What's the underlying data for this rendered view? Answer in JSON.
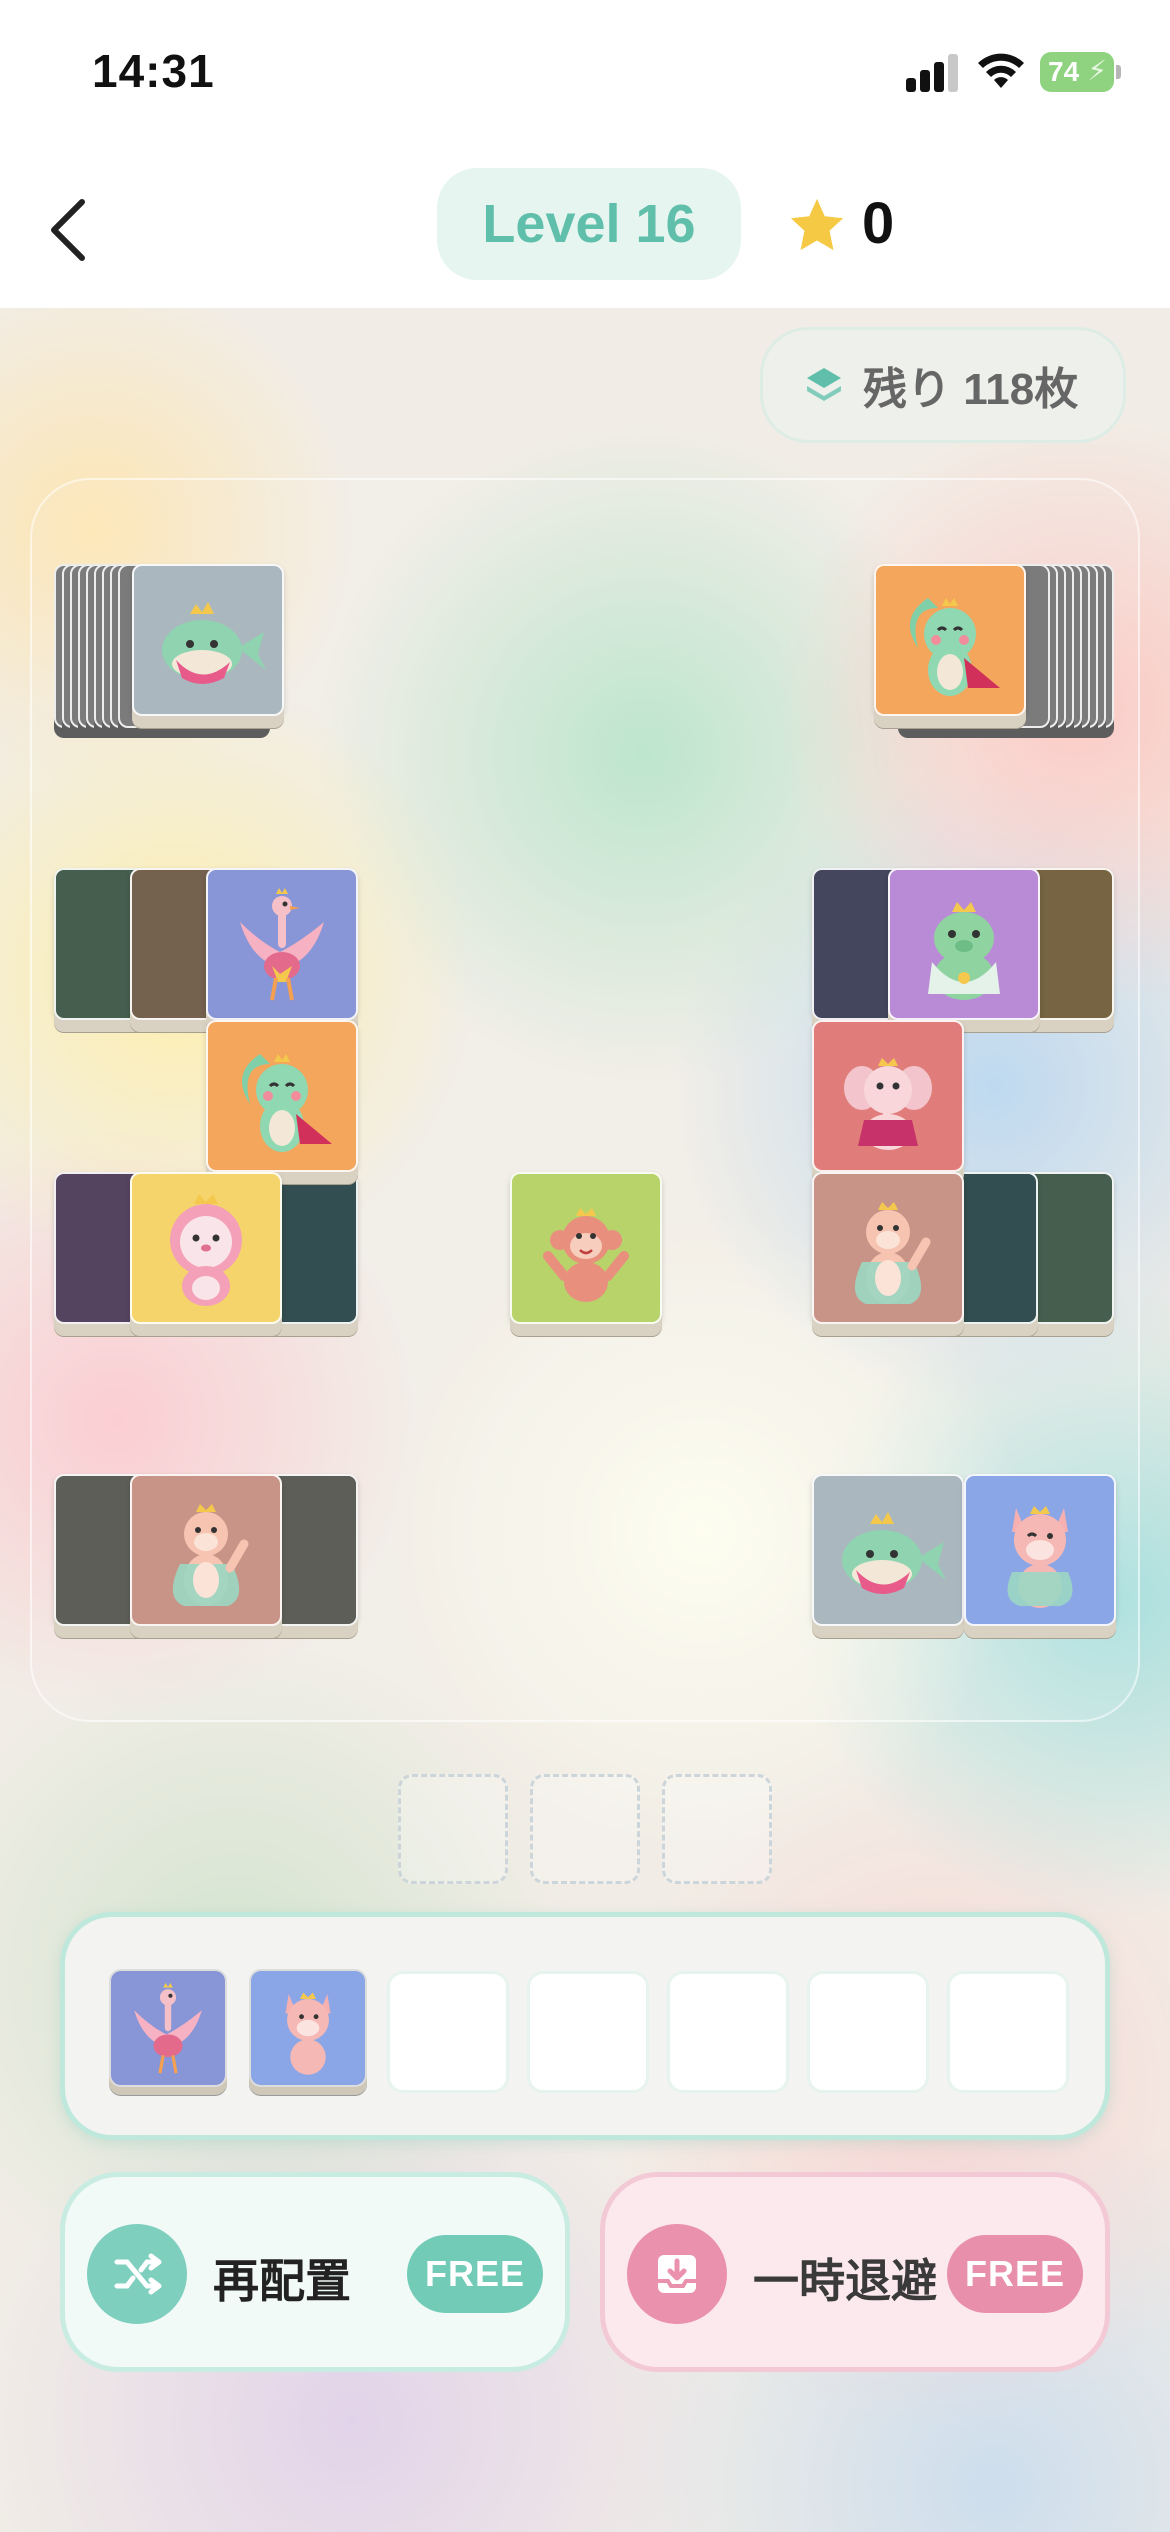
{
  "status_bar": {
    "time": "14:31",
    "battery": "74"
  },
  "header": {
    "level_label": "Level 16",
    "star_count": "0"
  },
  "remaining": {
    "label": "残り 118枚"
  },
  "tiles": [
    {
      "animal": "whale",
      "bg": "#aab7bf",
      "state": "top"
    },
    {
      "animal": "squirrel",
      "bg": "#f3a65c",
      "state": "top"
    },
    {
      "animal": "ostrich",
      "bg": "#8895d6",
      "state": "top"
    },
    {
      "animal": "capybara",
      "bg": "#b98ad6",
      "state": "top"
    },
    {
      "animal": "squirrel",
      "bg": "#f3a65c",
      "state": "top"
    },
    {
      "animal": "elephant",
      "bg": "#e07d7a",
      "state": "top"
    },
    {
      "animal": "lion",
      "bg": "#f4d46b",
      "state": "top"
    },
    {
      "animal": "monkey",
      "bg": "#b8d36a",
      "state": "top"
    },
    {
      "animal": "otter",
      "bg": "#c99488",
      "state": "top"
    },
    {
      "animal": "otter",
      "bg": "#c99488",
      "state": "top"
    },
    {
      "animal": "whale",
      "bg": "#aab7bf",
      "state": "top"
    },
    {
      "animal": "fox",
      "bg": "#8aa6e6",
      "state": "top"
    }
  ],
  "bottom_slots_count": 3,
  "tray": {
    "capacity": 7,
    "filled": [
      {
        "animal": "ostrich",
        "bg": "#8895d6"
      },
      {
        "animal": "fox",
        "bg": "#8aa6e6"
      }
    ]
  },
  "powerups": {
    "shuffle": {
      "label": "再配置",
      "badge": "FREE",
      "icon": "shuffle-icon",
      "color": "#7fcfbf"
    },
    "stash": {
      "label": "一時退避",
      "badge": "FREE",
      "icon": "stash-icon",
      "color": "#ea91ad"
    }
  }
}
